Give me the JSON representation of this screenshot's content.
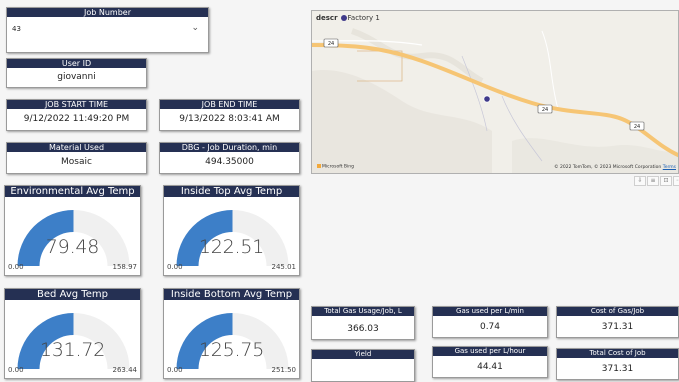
{
  "job_number": {
    "label": "Job Number",
    "value": "43"
  },
  "user_id": {
    "label": "User ID",
    "value": "giovanni"
  },
  "job_start": {
    "label": "JOB START TIME",
    "value": "9/12/2022 11:49:20 PM"
  },
  "job_end": {
    "label": "JOB END TIME",
    "value": "9/13/2022 8:03:41 AM"
  },
  "material": {
    "label": "Material Used",
    "value": "Mosaic"
  },
  "duration": {
    "label": "DBG - Job Duration, min",
    "value": "494.35000"
  },
  "gauges": [
    {
      "id": "env",
      "label": "Environmental Avg Temp",
      "value": 79.48,
      "value_text": "79.48",
      "min": 0,
      "min_text": "0.00",
      "max": 158.97,
      "max_text": "158.97"
    },
    {
      "id": "top",
      "label": "Inside Top Avg Temp",
      "value": 122.51,
      "value_text": "122.51",
      "min": 0,
      "min_text": "0.00",
      "max": 245.01,
      "max_text": "245.01"
    },
    {
      "id": "bed",
      "label": "Bed Avg Temp",
      "value": 131.72,
      "value_text": "131.72",
      "min": 0,
      "min_text": "0.00",
      "max": 263.44,
      "max_text": "263.44"
    },
    {
      "id": "bottom",
      "label": "Inside Bottom Avg Temp",
      "value": 125.75,
      "value_text": "125.75",
      "min": 0,
      "min_text": "0.00",
      "max": 251.5,
      "max_text": "251.50"
    }
  ],
  "map": {
    "legend_title": "descr",
    "legend_item": "Factory 1",
    "attribution": "© 2022 TomTom, © 2023 Microsoft Corporation",
    "terms": "Terms",
    "provider": "Microsoft Bing",
    "road_shields": [
      "24",
      "24",
      "24"
    ]
  },
  "visual_icons": [
    "⇩",
    "≡",
    "⊡",
    "⋯"
  ],
  "metrics": {
    "total_gas": {
      "label": "Total Gas Usage/Job, L",
      "value": "366.03"
    },
    "gas_per_min": {
      "label": "Gas used per L/min",
      "value": "0.74"
    },
    "cost_gas": {
      "label": "Cost of Gas/Job",
      "value": "371.31"
    },
    "yield": {
      "label": "Yield",
      "value": ""
    },
    "gas_per_hour": {
      "label": "Gas used per L/hour",
      "value": "44.41"
    },
    "total_cost": {
      "label": "Total Cost of Job",
      "value": "371.31"
    }
  },
  "colors": {
    "header": "#253053",
    "gauge_fill": "#3d7fc8",
    "gauge_track": "#f0f0f0",
    "map_land": "#f1efe9",
    "road": "#f6c574",
    "marker": "#3f3a8a"
  }
}
